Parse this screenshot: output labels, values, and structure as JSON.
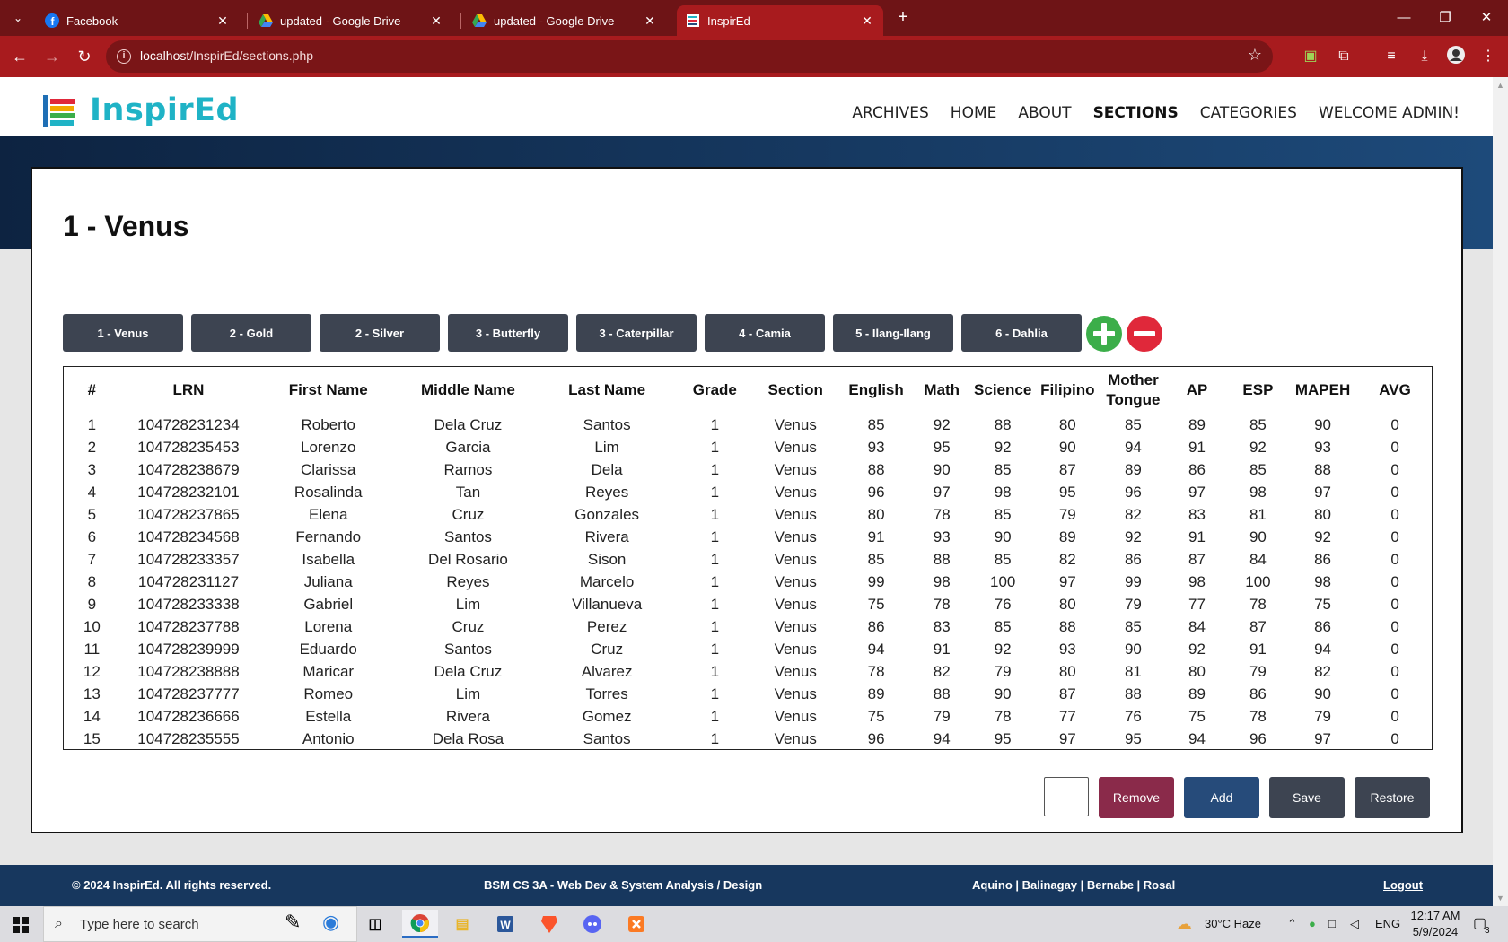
{
  "browser": {
    "tabs": [
      {
        "title": "Facebook",
        "icon": "facebook-icon",
        "active": false
      },
      {
        "title": "updated - Google Drive",
        "icon": "google-drive-icon",
        "active": false
      },
      {
        "title": "updated - Google Drive",
        "icon": "google-drive-icon",
        "active": false
      },
      {
        "title": "InspirEd",
        "icon": "inspired-favicon",
        "active": true
      }
    ],
    "url_host": "localhost",
    "url_path": "/InspirEd/sections.php"
  },
  "site": {
    "logo_text": "InspirEd",
    "nav": [
      "ARCHIVES",
      "HOME",
      "ABOUT",
      "SECTIONS",
      "CATEGORIES",
      "WELCOME ADMIN!"
    ],
    "current_nav": "SECTIONS"
  },
  "page": {
    "title": "1 - Venus",
    "sections": [
      "1 - Venus",
      "2 - Gold",
      "2 - Silver",
      "3 - Butterfly",
      "3 - Caterpillar",
      "4 - Camia",
      "5 - Ilang-Ilang",
      "6 - Dahlia"
    ]
  },
  "table": {
    "headers": [
      "#",
      "LRN",
      "First Name",
      "Middle Name",
      "Last Name",
      "Grade",
      "Section",
      "English",
      "Math",
      "Science",
      "Filipino",
      "Mother Tongue",
      "AP",
      "ESP",
      "MAPEH",
      "AVG"
    ],
    "rows": [
      [
        "1",
        "104728231234",
        "Roberto",
        "Dela Cruz",
        "Santos",
        "1",
        "Venus",
        "85",
        "92",
        "88",
        "80",
        "85",
        "89",
        "85",
        "90",
        "0"
      ],
      [
        "2",
        "104728235453",
        "Lorenzo",
        "Garcia",
        "Lim",
        "1",
        "Venus",
        "93",
        "95",
        "92",
        "90",
        "94",
        "91",
        "92",
        "93",
        "0"
      ],
      [
        "3",
        "104728238679",
        "Clarissa",
        "Ramos",
        "Dela",
        "1",
        "Venus",
        "88",
        "90",
        "85",
        "87",
        "89",
        "86",
        "85",
        "88",
        "0"
      ],
      [
        "4",
        "104728232101",
        "Rosalinda",
        "Tan",
        "Reyes",
        "1",
        "Venus",
        "96",
        "97",
        "98",
        "95",
        "96",
        "97",
        "98",
        "97",
        "0"
      ],
      [
        "5",
        "104728237865",
        "Elena",
        "Cruz",
        "Gonzales",
        "1",
        "Venus",
        "80",
        "78",
        "85",
        "79",
        "82",
        "83",
        "81",
        "80",
        "0"
      ],
      [
        "6",
        "104728234568",
        "Fernando",
        "Santos",
        "Rivera",
        "1",
        "Venus",
        "91",
        "93",
        "90",
        "89",
        "92",
        "91",
        "90",
        "92",
        "0"
      ],
      [
        "7",
        "104728233357",
        "Isabella",
        "Del Rosario",
        "Sison",
        "1",
        "Venus",
        "85",
        "88",
        "85",
        "82",
        "86",
        "87",
        "84",
        "86",
        "0"
      ],
      [
        "8",
        "104728231127",
        "Juliana",
        "Reyes",
        "Marcelo",
        "1",
        "Venus",
        "99",
        "98",
        "100",
        "97",
        "99",
        "98",
        "100",
        "98",
        "0"
      ],
      [
        "9",
        "104728233338",
        "Gabriel",
        "Lim",
        "Villanueva",
        "1",
        "Venus",
        "75",
        "78",
        "76",
        "80",
        "79",
        "77",
        "78",
        "75",
        "0"
      ],
      [
        "10",
        "104728237788",
        "Lorena",
        "Cruz",
        "Perez",
        "1",
        "Venus",
        "86",
        "83",
        "85",
        "88",
        "85",
        "84",
        "87",
        "86",
        "0"
      ],
      [
        "11",
        "104728239999",
        "Eduardo",
        "Santos",
        "Cruz",
        "1",
        "Venus",
        "94",
        "91",
        "92",
        "93",
        "90",
        "92",
        "91",
        "94",
        "0"
      ],
      [
        "12",
        "104728238888",
        "Maricar",
        "Dela Cruz",
        "Alvarez",
        "1",
        "Venus",
        "78",
        "82",
        "79",
        "80",
        "81",
        "80",
        "79",
        "82",
        "0"
      ],
      [
        "13",
        "104728237777",
        "Romeo",
        "Lim",
        "Torres",
        "1",
        "Venus",
        "89",
        "88",
        "90",
        "87",
        "88",
        "89",
        "86",
        "90",
        "0"
      ],
      [
        "14",
        "104728236666",
        "Estella",
        "Rivera",
        "Gomez",
        "1",
        "Venus",
        "75",
        "79",
        "78",
        "77",
        "76",
        "75",
        "78",
        "79",
        "0"
      ],
      [
        "15",
        "104728235555",
        "Antonio",
        "Dela Rosa",
        "Santos",
        "1",
        "Venus",
        "96",
        "94",
        "95",
        "97",
        "95",
        "94",
        "96",
        "97",
        "0"
      ]
    ]
  },
  "actions": {
    "input_value": "",
    "remove": "Remove",
    "add": "Add",
    "save": "Save",
    "restore": "Restore"
  },
  "footer": {
    "copyright": "© 2024 InspirEd. All rights reserved.",
    "course": "BSM CS 3A - Web Dev & System Analysis / Design",
    "authors": "Aquino | Balinagay | Bernabe | Rosal",
    "logout": "Logout"
  },
  "taskbar": {
    "search_placeholder": "Type here to search",
    "weather": "30°C  Haze",
    "lang": "ENG",
    "time": "12:17 AM",
    "date": "5/9/2024",
    "notification_count": "3"
  },
  "colors": {
    "chrome_dark": "#6e1416",
    "chrome_red": "#a81b1e",
    "logo": "#1fb3c6",
    "section_button": "#3d4451",
    "add_circle": "#3cae4a",
    "remove_circle": "#e0283a",
    "remove_button": "#8a2a4a",
    "add_button": "#264b7a",
    "save_button": "#3d4451",
    "footer": "#17375e"
  }
}
